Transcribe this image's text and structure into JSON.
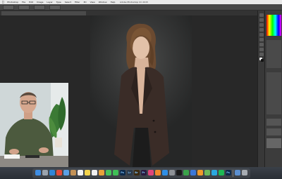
{
  "menubar": {
    "apple": "",
    "items": [
      "Photoshop",
      "File",
      "Edit",
      "Image",
      "Layer",
      "Type",
      "Select",
      "Filter",
      "3D",
      "View",
      "Window",
      "Help"
    ],
    "window_title": "Adobe Photoshop CC 2015",
    "status": ""
  },
  "tab": {
    "label": ""
  },
  "colors": {
    "background": "#2b2b2b",
    "canvas": "#282828",
    "panel": "#3c3c3c"
  },
  "dock": {
    "items": [
      {
        "name": "finder-icon",
        "label": "",
        "color": "#3e8de3"
      },
      {
        "name": "launchpad-icon",
        "label": "",
        "color": "#9aa3ad"
      },
      {
        "name": "safari-icon",
        "label": "",
        "color": "#2f86d8"
      },
      {
        "name": "chrome-icon",
        "label": "",
        "color": "#e44b3a"
      },
      {
        "name": "mail-icon",
        "label": "",
        "color": "#5ba0e6"
      },
      {
        "name": "contacts-icon",
        "label": "",
        "color": "#c39257"
      },
      {
        "name": "calendar-icon",
        "label": "",
        "color": "#f2f2f2"
      },
      {
        "name": "notes-icon",
        "label": "",
        "color": "#f4d44c"
      },
      {
        "name": "reminders-icon",
        "label": "",
        "color": "#f0f0f0"
      },
      {
        "name": "photos-icon",
        "label": "",
        "color": "#e9a23b"
      },
      {
        "name": "messages-icon",
        "label": "",
        "color": "#48c25b"
      },
      {
        "name": "facetime-icon",
        "label": "",
        "color": "#3fbf56"
      },
      {
        "name": "photoshop-icon",
        "label": "Ps",
        "color": "#0d2a4a"
      },
      {
        "name": "lightroom-icon",
        "label": "Lr",
        "color": "#2b3a4a"
      },
      {
        "name": "bridge-icon",
        "label": "Br",
        "color": "#3b2a10"
      },
      {
        "name": "premiere-icon",
        "label": "Pr",
        "color": "#2a1b3f"
      },
      {
        "name": "itunes-icon",
        "label": "",
        "color": "#e0467a"
      },
      {
        "name": "ibooks-icon",
        "label": "",
        "color": "#f08a2b"
      },
      {
        "name": "appstore-icon",
        "label": "",
        "color": "#2f8fe6"
      },
      {
        "name": "system-preferences-icon",
        "label": "",
        "color": "#8d9196"
      },
      {
        "name": "terminal-icon",
        "label": "",
        "color": "#1a1a1a"
      },
      {
        "name": "numbers-icon",
        "label": "",
        "color": "#3aa34a"
      },
      {
        "name": "keynote-icon",
        "label": "",
        "color": "#3c78d8"
      },
      {
        "name": "pages-icon",
        "label": "",
        "color": "#f09a2a"
      },
      {
        "name": "maps-icon",
        "label": "",
        "color": "#6cb85a"
      },
      {
        "name": "skype-icon",
        "label": "",
        "color": "#2aa8e0"
      },
      {
        "name": "spotify-icon",
        "label": "",
        "color": "#1db954"
      },
      {
        "name": "photoshop2-icon",
        "label": "Ps",
        "color": "#0d2a4a"
      },
      {
        "name": "downloads-icon",
        "label": "",
        "color": "#5b8fd0"
      },
      {
        "name": "trash-icon",
        "label": "",
        "color": "#a8adb3"
      }
    ]
  }
}
